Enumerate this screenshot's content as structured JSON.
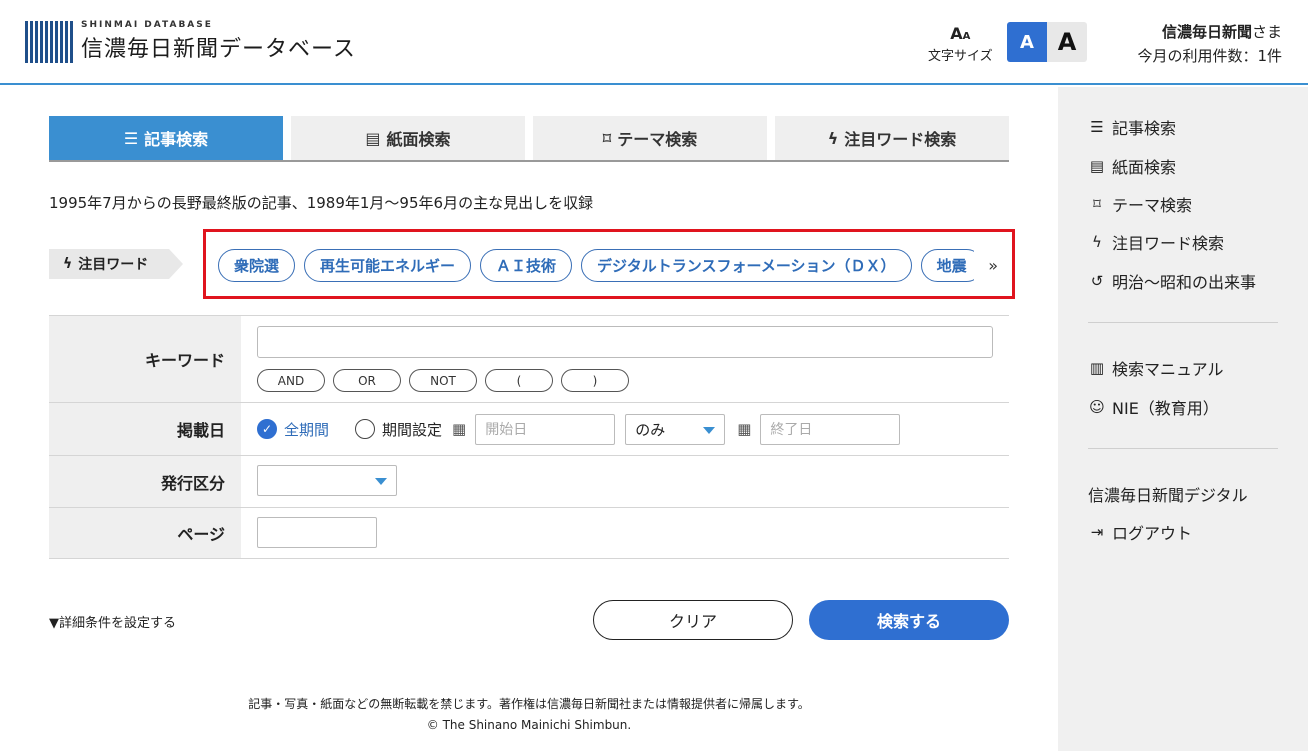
{
  "header": {
    "logo_sub": "SHINMAI DATABASE",
    "logo_main": "信濃毎日新聞データベース",
    "font_size_label": "文字サイズ",
    "font_small": "A",
    "font_large": "A",
    "user_name": "信濃毎日新聞",
    "user_suffix": "さま",
    "usage": "今月の利用件数：1件"
  },
  "tabs": [
    {
      "icon": "list-icon",
      "label": "記事検索"
    },
    {
      "icon": "newspaper-icon",
      "label": "紙面検索"
    },
    {
      "icon": "bookmark-icon",
      "label": "テーマ検索"
    },
    {
      "icon": "bolt-icon",
      "label": "注目ワード検索"
    }
  ],
  "description": "1995年7月からの長野最終版の記事、1989年1月〜95年6月の主な見出しを収録",
  "attention": {
    "label": "注目ワード",
    "chips": [
      "衆院選",
      "再生可能エネルギー",
      "ＡＩ技術",
      "デジタルトランスフォーメーション（ＤＸ）",
      "地震"
    ]
  },
  "form": {
    "keyword_label": "キーワード",
    "operators": [
      "AND",
      "OR",
      "NOT",
      "(",
      ")"
    ],
    "date_label": "掲載日",
    "all_period": "全期間",
    "set_period": "期間設定",
    "start_placeholder": "開始日",
    "range_select": "のみ",
    "end_placeholder": "終了日",
    "issue_label": "発行区分",
    "page_label": "ページ"
  },
  "actions": {
    "detail": "▼詳細条件を設定する",
    "clear": "クリア",
    "search": "検索する"
  },
  "sidebar": {
    "items": [
      {
        "icon": "list-icon",
        "label": "記事検索"
      },
      {
        "icon": "newspaper-icon",
        "label": "紙面検索"
      },
      {
        "icon": "bookmark-icon",
        "label": "テーマ検索"
      },
      {
        "icon": "bolt-icon",
        "label": "注目ワード検索"
      },
      {
        "icon": "history-icon",
        "label": "明治〜昭和の出来事"
      },
      {
        "icon": "manual-icon",
        "label": "検索マニュアル"
      },
      {
        "icon": "nie-icon",
        "label": "NIE（教育用）"
      },
      {
        "icon": "",
        "label": "信濃毎日新聞デジタル"
      },
      {
        "icon": "logout-icon",
        "label": "ログアウト"
      }
    ]
  },
  "footer": {
    "notice": "記事・写真・紙面などの無断転載を禁じます。著作権は信濃毎日新聞社または情報提供者に帰属します。",
    "copyright": "© The Shinano Mainichi Shimbun."
  },
  "colors": {
    "accent": "#3a8fd1",
    "button": "#2f6fd1",
    "highlight": "#e0141e"
  }
}
